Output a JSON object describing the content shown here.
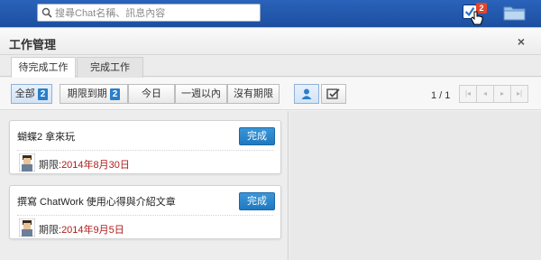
{
  "header": {
    "search_placeholder": "搜尋Chat名稱、訊息內容",
    "task_badge_count": "2"
  },
  "panel": {
    "title": "工作管理",
    "close_glyph": "×"
  },
  "tabs": [
    {
      "label": "待完成工作",
      "active": true
    },
    {
      "label": "完成工作",
      "active": false
    }
  ],
  "filters": {
    "all_label": "全部",
    "all_count": "2",
    "due_label": "期限到期",
    "due_count": "2",
    "today_label": "今日",
    "week_label": "一週以內",
    "none_label": "沒有期限"
  },
  "pager": {
    "label": "1 / 1"
  },
  "tasks": [
    {
      "title": "蝴蝶2 拿來玩",
      "done_label": "完成",
      "deadline_prefix": "期限:",
      "deadline_date": "2014年8月30日"
    },
    {
      "title": "撰寫 ChatWork  使用心得與介紹文章",
      "done_label": "完成",
      "deadline_prefix": "期限:",
      "deadline_date": "2014年9月5日"
    }
  ],
  "colors": {
    "topbar": "#1f4f9b",
    "accent_blue": "#2a7fc8",
    "deadline_red": "#b01c1c",
    "badge_red": "#e2452a"
  }
}
